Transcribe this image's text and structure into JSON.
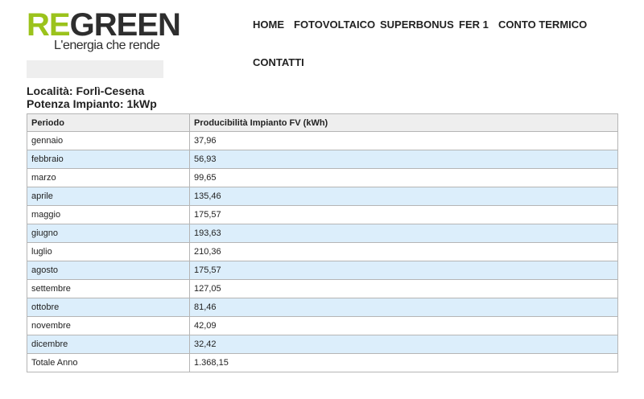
{
  "logo": {
    "word_green": "RE",
    "word_dark": "GREEN",
    "tagline": "L'energia che rende",
    "brand_green": "#9bc31c"
  },
  "nav": {
    "items": [
      "HOME",
      "FOTOVOLTAICO",
      "SUPERBONUS",
      "FER 1",
      "CONTO TERMICO",
      "CONTATTI"
    ]
  },
  "info": {
    "location": "Località: Forlì-Cesena",
    "power": "Potenza Impianto: 1kWp"
  },
  "table": {
    "headers": [
      "Periodo",
      "Producibilità Impianto FV (kWh)"
    ],
    "rows": [
      [
        "gennaio",
        "37,96"
      ],
      [
        "febbraio",
        "56,93"
      ],
      [
        "marzo",
        "99,65"
      ],
      [
        "aprile",
        "135,46"
      ],
      [
        "maggio",
        "175,57"
      ],
      [
        "giugno",
        "193,63"
      ],
      [
        "luglio",
        "210,36"
      ],
      [
        "agosto",
        "175,57"
      ],
      [
        "settembre",
        "127,05"
      ],
      [
        "ottobre",
        "81,46"
      ],
      [
        "novembre",
        "42,09"
      ],
      [
        "dicembre",
        "32,42"
      ],
      [
        "Totale Anno",
        "1.368,15"
      ]
    ],
    "alt_row_color": "#dceefb"
  }
}
